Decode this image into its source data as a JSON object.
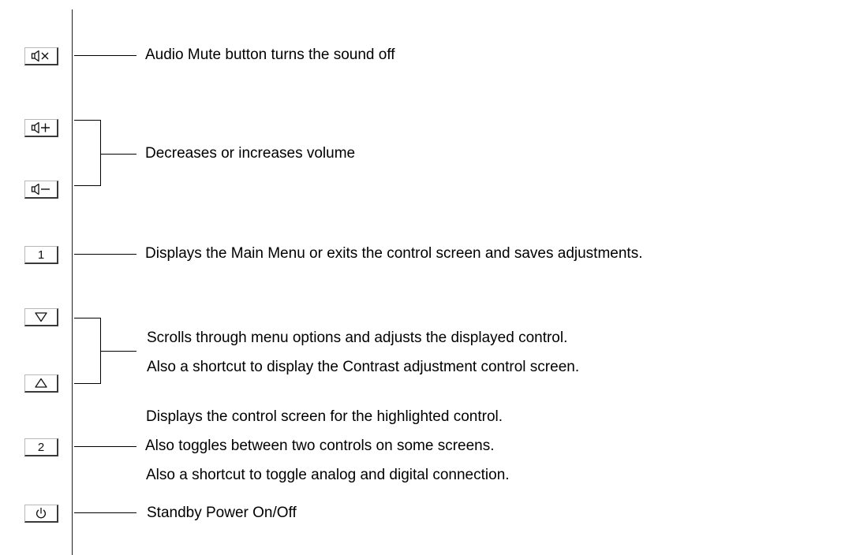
{
  "buttons": {
    "mute": {
      "icon": "speaker-mute-icon"
    },
    "volume_up": {
      "icon": "speaker-plus-icon"
    },
    "volume_down": {
      "icon": "speaker-minus-icon"
    },
    "menu": {
      "label": "1"
    },
    "down": {
      "icon": "triangle-down-icon"
    },
    "up": {
      "icon": "triangle-up-icon"
    },
    "select": {
      "label": "2"
    },
    "power": {
      "icon": "power-icon"
    }
  },
  "descriptions": {
    "mute": "Audio Mute button turns the sound off",
    "volume": "Decreases or increases volume",
    "menu": "Displays the Main Menu or exits the control screen and saves adjustments.",
    "scroll_line1": "Scrolls through menu options and adjusts the displayed control.",
    "scroll_line2": "Also a shortcut to display the Contrast adjustment control screen.",
    "select_line1": "Displays the control screen for the highlighted control.",
    "select_line2": "Also toggles between two controls on some screens.",
    "select_line3": "Also a shortcut to toggle analog and digital connection.",
    "power": "Standby Power On/Off"
  },
  "colors": {
    "line": "#000000",
    "button_shadow": "#3a3a3a",
    "button_highlight": "#b8b8b8"
  }
}
